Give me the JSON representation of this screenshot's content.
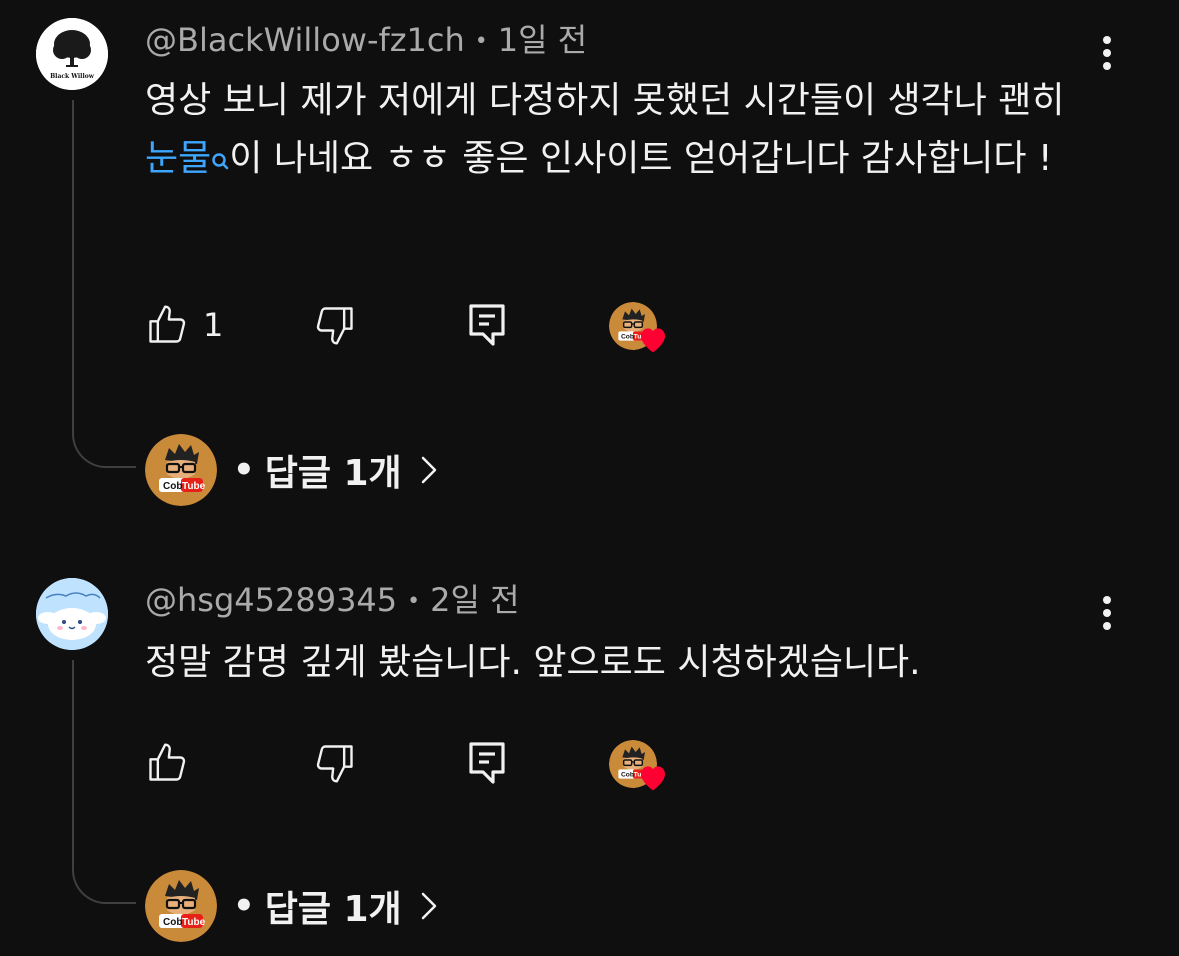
{
  "comments": [
    {
      "handle": "@BlackWillow-fz1ch",
      "time": "1일 전",
      "avatar_caption": "Black Willow",
      "body_before": "영상 보니 제가 저에게 다정하지 못했던 시간들이 생각나 괜히 ",
      "body_link": "눈물",
      "body_after": "이 나네요 ㅎㅎ 좋은 인사이트 얻어갑니다 감사합니다 !",
      "like_count": "1",
      "replies_label": "답글 1개",
      "creator_badge": "CobTube"
    },
    {
      "handle": "@hsg45289345",
      "time": "2일 전",
      "body": "정말 감명 깊게 봤습니다. 앞으로도 시청하겠습니다.",
      "like_count": "",
      "replies_label": "답글 1개",
      "creator_badge": "CobTube"
    }
  ],
  "icons": {
    "like": "thumbs-up-icon",
    "dislike": "thumbs-down-icon",
    "reply": "reply-icon",
    "more": "more-vert-icon",
    "heart": "heart-icon",
    "chevron": "chevron-right-icon"
  },
  "colors": {
    "background": "#0f0f0f",
    "text": "#f1f1f1",
    "meta": "#aaaaaa",
    "link": "#3ea6ff",
    "heart": "#ff0033",
    "creator_avatar": "#c98a3a"
  }
}
